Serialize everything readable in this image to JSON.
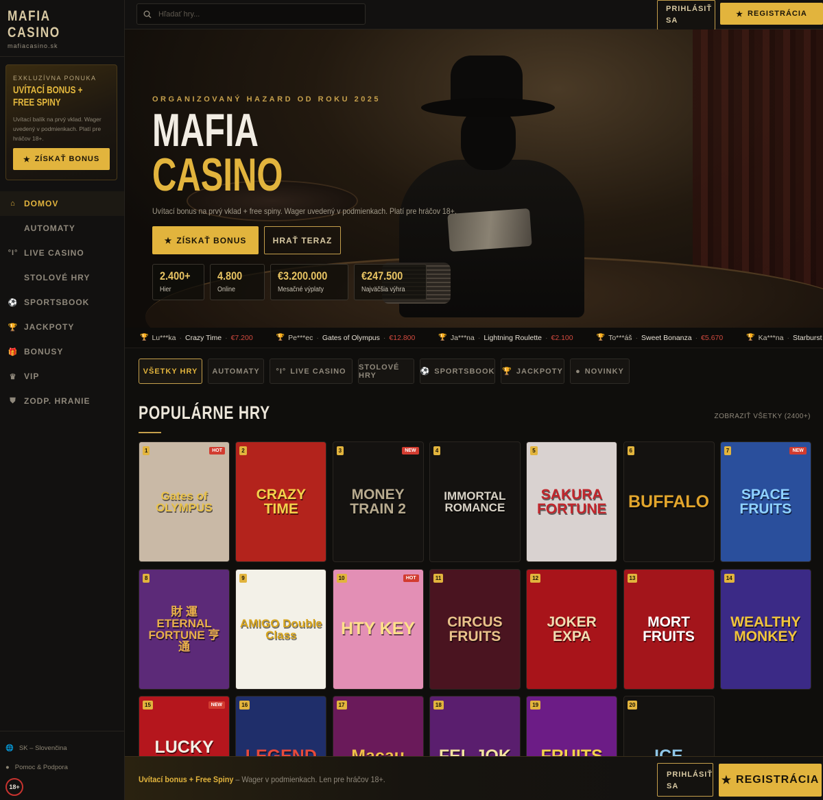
{
  "brand": {
    "line1": "MAFIA",
    "line2": "CASINO",
    "domain": "mafiacasino.sk"
  },
  "promo": {
    "kicker": "EXKLUZÍVNA PONUKA",
    "title": "UVÍTACÍ BONUS + FREE SPINY",
    "desc": "Uvítací balík na prvý vklad. Wager uvedený v podmienkach. Platí pre hráčov 18+.",
    "button": "ZÍSKAŤ BONUS"
  },
  "nav": [
    {
      "label": "DOMOV",
      "icon": "home-icon",
      "glyph": "⌂",
      "active": true
    },
    {
      "label": "AUTOMATY",
      "icon": "",
      "glyph": "",
      "active": false
    },
    {
      "label": "LIVE CASINO",
      "icon": "live-icon",
      "glyph": "°I°",
      "active": false
    },
    {
      "label": "STOLOVÉ HRY",
      "icon": "",
      "glyph": "",
      "active": false
    },
    {
      "label": "SPORTSBOOK",
      "icon": "ball-icon",
      "glyph": "⚽",
      "active": false
    },
    {
      "label": "JACKPOTY",
      "icon": "trophy-icon",
      "glyph": "🏆",
      "active": false
    },
    {
      "label": "BONUSY",
      "icon": "gift-icon",
      "glyph": "🎁",
      "active": false
    },
    {
      "label": "VIP",
      "icon": "crown-icon",
      "glyph": "♛",
      "active": false
    },
    {
      "label": "ZODP. HRANIE",
      "icon": "shield-icon",
      "glyph": "⛊",
      "active": false
    }
  ],
  "footer": {
    "language": "SK – Slovenčina",
    "support": "Pomoc & Podpora",
    "age": "18+"
  },
  "search": {
    "placeholder": "Hľadať hry..."
  },
  "top": {
    "login": "PRIHLÁSIŤ SA",
    "register": "REGISTRÁCIA"
  },
  "hero": {
    "kicker": "ORGANIZOVANÝ HAZARD OD ROKU 2025",
    "title1": "MAFIA",
    "title2": "CASINO",
    "subtitle": "Uvítací bonus na prvý vklad + free spiny. Wager uvedený v podmienkach. Platí pre hráčov 18+.",
    "cta_primary": "ZÍSKAŤ BONUS",
    "cta_secondary": "HRAŤ TERAZ",
    "stats": [
      {
        "value": "2.400+",
        "label": "Hier"
      },
      {
        "value": "4.800",
        "label": "Online"
      },
      {
        "value": "€3.200.000",
        "label": "Mesačné výplaty"
      },
      {
        "value": "€247.500",
        "label": "Najväčšia výhra"
      }
    ]
  },
  "ticker": [
    {
      "user": "Lu***ka",
      "game": "Crazy Time",
      "amount": "€7.200"
    },
    {
      "user": "Pe***ec",
      "game": "Gates of Olympus",
      "amount": "€12.800"
    },
    {
      "user": "Ja***na",
      "game": "Lightning Roulette",
      "amount": "€2.100"
    },
    {
      "user": "To***áš",
      "game": "Sweet Bonanza",
      "amount": "€5.670"
    },
    {
      "user": "Ka***na",
      "game": "Starburst X",
      "amount": ""
    }
  ],
  "filters": [
    {
      "label": "VŠETKY HRY",
      "glyph": "",
      "icon": "",
      "active": true
    },
    {
      "label": "AUTOMATY",
      "glyph": "",
      "icon": "",
      "active": false
    },
    {
      "label": "LIVE CASINO",
      "glyph": "°I°",
      "icon": "live-icon",
      "active": false
    },
    {
      "label": "STOLOVÉ HRY",
      "glyph": "",
      "icon": "",
      "active": false
    },
    {
      "label": "SPORTSBOOK",
      "glyph": "⚽",
      "icon": "ball-icon",
      "active": false
    },
    {
      "label": "JACKPOTY",
      "glyph": "🏆",
      "icon": "trophy-icon",
      "active": false
    },
    {
      "label": "NOVINKY",
      "glyph": "●",
      "icon": "new-icon",
      "active": false
    }
  ],
  "section": {
    "title": "POPULÁRNE HRY",
    "show_all": "ZOBRAZIŤ VŠETKY (2400+)"
  },
  "games": [
    {
      "num": "1",
      "badge": "HOT",
      "art": "Gates of OLYMPUS",
      "bg": "#c9b9a6",
      "fg": "#e9c24a"
    },
    {
      "num": "2",
      "badge": "",
      "art": "CRAZY TIME",
      "bg": "#b3231c",
      "fg": "#f4d24c"
    },
    {
      "num": "3",
      "badge": "NEW",
      "art": "MONEY TRAIN 2",
      "bg": "#141210",
      "fg": "#b8ab8f"
    },
    {
      "num": "4",
      "badge": "",
      "art": "IMMORTAL ROMANCE",
      "bg": "#141210",
      "fg": "#d8d2c6"
    },
    {
      "num": "5",
      "badge": "",
      "art": "SAKURA FORTUNE",
      "bg": "#d9d2d0",
      "fg": "#c1262c"
    },
    {
      "num": "6",
      "badge": "",
      "art": "BUFFALO",
      "bg": "#141210",
      "fg": "#e2a52c"
    },
    {
      "num": "7",
      "badge": "NEW",
      "art": "SPACE FRUITS",
      "bg": "#2a4f9c",
      "fg": "#8fd2ff"
    },
    {
      "num": "8",
      "badge": "",
      "art": "財 運 ETERNAL FORTUNE 亨 通",
      "bg": "#5c2a78",
      "fg": "#e9b04a"
    },
    {
      "num": "9",
      "badge": "",
      "art": "AMIGO Double Class",
      "bg": "#f3f1e8",
      "fg": "#d8a51c"
    },
    {
      "num": "10",
      "badge": "HOT",
      "art": "HTY KEY",
      "bg": "#e38fb5",
      "fg": "#ffe08a"
    },
    {
      "num": "11",
      "badge": "",
      "art": "CIRCUS FRUITS",
      "bg": "#4a1420",
      "fg": "#e9c28a"
    },
    {
      "num": "12",
      "badge": "",
      "art": "JOKER EXPA",
      "bg": "#a8141a",
      "fg": "#f1ddb2"
    },
    {
      "num": "13",
      "badge": "",
      "art": "MORT FRUITS",
      "bg": "#a3151b",
      "fg": "#ffffff"
    },
    {
      "num": "14",
      "badge": "",
      "art": "WEALTHY MONKEY",
      "bg": "#3b2a86",
      "fg": "#f2c53c"
    },
    {
      "num": "15",
      "badge": "NEW",
      "art": "LUCKY CAT",
      "bg": "#b5161d",
      "fg": "#f3efe5"
    },
    {
      "num": "16",
      "badge": "",
      "art": "LEGEND",
      "bg": "#1f2e6a",
      "fg": "#e84a3a"
    },
    {
      "num": "17",
      "badge": "",
      "art": "Macau",
      "bg": "#6a1a5a",
      "fg": "#f0c04a"
    },
    {
      "num": "18",
      "badge": "",
      "art": "FEL JOK",
      "bg": "#5a1e6e",
      "fg": "#f3e3a0"
    },
    {
      "num": "19",
      "badge": "",
      "art": "FRUITS",
      "bg": "#6c1c86",
      "fg": "#f3d24c"
    },
    {
      "num": "20",
      "badge": "",
      "art": "ICE",
      "bg": "#141210",
      "fg": "#8fc6e6"
    }
  ],
  "bottom": {
    "bonus": "Uvítací bonus + Free Spiny",
    "note": " – Wager v podmienkach. Len pre hráčov 18+.",
    "login": "PRIHLÁSIŤ SA",
    "register": "REGISTRÁCIA"
  },
  "colors": {
    "accent": "#e2b43d",
    "badge_hot": "#d23c30",
    "amount": "#d24a3f",
    "bg": "#0f0e0c"
  }
}
